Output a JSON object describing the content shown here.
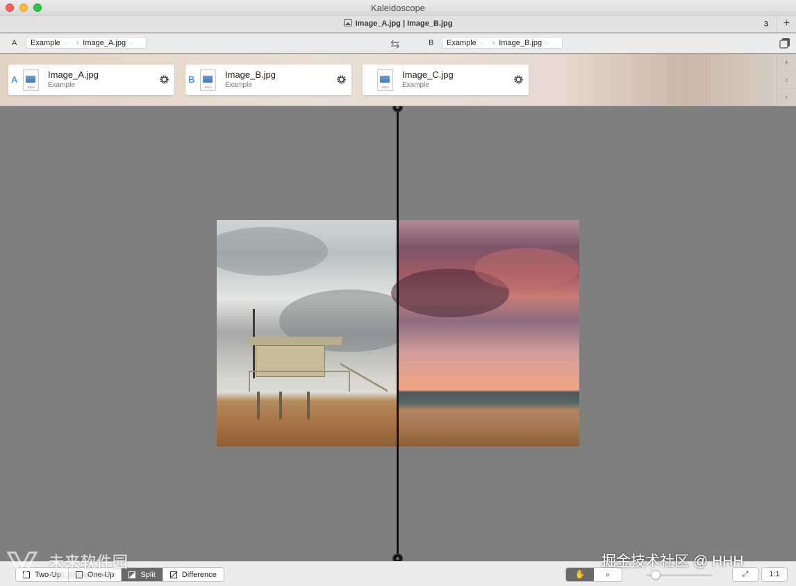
{
  "window": {
    "title": "Kaleidoscope"
  },
  "tab": {
    "title": "Image_A.jpg | Image_B.jpg",
    "count": "3",
    "add_label": "+"
  },
  "pathbar": {
    "left": {
      "letter": "A",
      "folder": "Example",
      "file": "Image_A.jpg"
    },
    "right": {
      "letter": "B",
      "folder": "Example",
      "file": "Image_B.jpg"
    },
    "swap_icon": "swap-arrows-icon"
  },
  "shelf": {
    "files": [
      {
        "letter": "A",
        "name": "Image_A.jpg",
        "folder": "Example",
        "type": "JPEG"
      },
      {
        "letter": "B",
        "name": "Image_B.jpg",
        "folder": "Example",
        "type": "JPEG"
      },
      {
        "letter": "",
        "name": "Image_C.jpg",
        "folder": "Example",
        "type": "JPEG"
      }
    ],
    "controls": [
      "+",
      "›",
      "‹"
    ]
  },
  "toolbar": {
    "modes": [
      "Two-Up",
      "One-Up",
      "Split",
      "Difference"
    ],
    "active_mode": "Split",
    "tools": {
      "hand_icon": "✋",
      "zoom_icon": "⌕"
    },
    "fit_label": "⤢",
    "actual_size_label": "1:1"
  },
  "watermarks": {
    "left_cn": "未来软件园",
    "left_url": "mac.orsoon.com",
    "right": "掘金技术社区 @ HHH"
  },
  "colors": {
    "accent_letter": "#4a9ae0",
    "active_segment": "#6a6a6a",
    "canvas": "#7f7f7f"
  }
}
